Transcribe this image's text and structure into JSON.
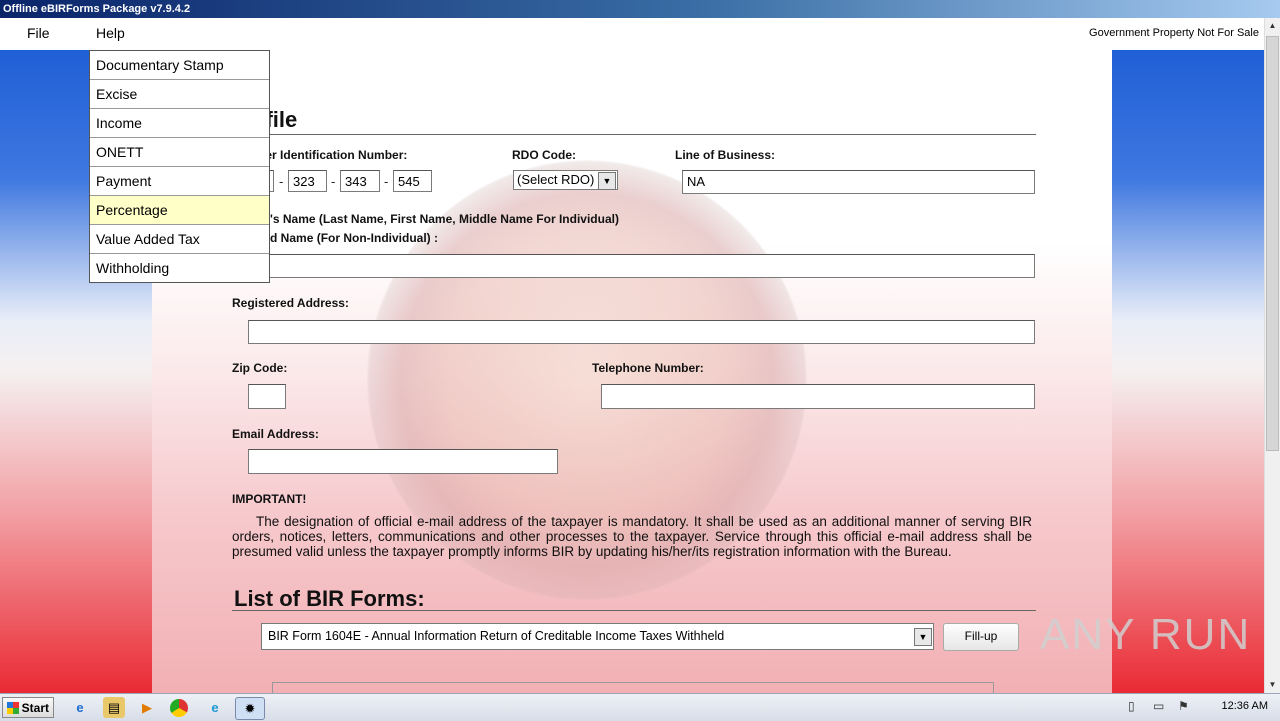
{
  "window": {
    "title": "Offline eBIRForms Package v7.9.4.2"
  },
  "menubar": {
    "file": "File",
    "help": "Help",
    "notice": "Government Property Not For Sale"
  },
  "dropdown": {
    "items": [
      "Documentary Stamp",
      "Excise",
      "Income",
      "ONETT",
      "Payment",
      "Percentage",
      "Value Added Tax",
      "Withholding"
    ],
    "highlighted": "Percentage"
  },
  "profile": {
    "heading_visible": "ofile",
    "tin_label_visible": "ayer Identification Number:",
    "tin": [
      "323",
      "343",
      "545"
    ],
    "rdo_label": "RDO Code:",
    "rdo_selected": "(Select RDO)",
    "lob_label": "Line of Business:",
    "lob_value": "NA",
    "name_label_1": "yer's Name (Last Name, First Name, Middle Name For Individual)",
    "name_label_2": "ered Name (For Non-Individual) :",
    "address_label": "Registered Address:",
    "zip_label": "Zip Code:",
    "tel_label": "Telephone Number:",
    "email_label": "Email Address:",
    "important_label": "IMPORTANT!",
    "important_text": "The designation of official e-mail address of the taxpayer is mandatory. It shall be used as an additional manner of serving BIR orders, notices, letters, communications and other processes to the taxpayer. Service through this official e-mail address shall be presumed valid unless the taxpayer promptly informs BIR by updating his/her/its registration information with the Bureau."
  },
  "forms": {
    "heading": "List of BIR Forms:",
    "selected": "BIR Form 1604E - Annual Information Return of Creditable Income Taxes Withheld",
    "fillup_label": "Fill-up"
  },
  "watermark": "ANY RUN",
  "taskbar": {
    "start_label": "Start",
    "clock": "12:36 AM"
  },
  "colors": {
    "highlight": "#ffffc8",
    "title_bar": "#0a246a"
  }
}
